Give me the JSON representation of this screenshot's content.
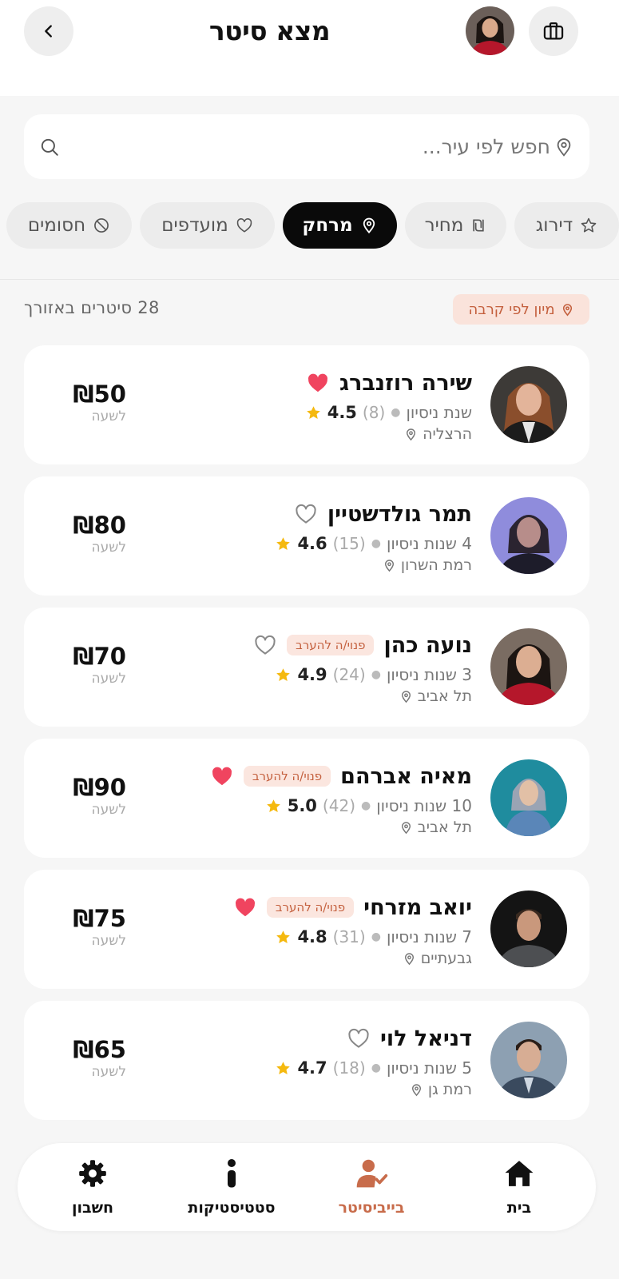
{
  "header": {
    "title": "מצא סיטר",
    "back_icon": "chevron-left-icon",
    "bag_icon": "briefcase-icon"
  },
  "search": {
    "placeholder": "חפש לפי עיר...",
    "value": ""
  },
  "filters": [
    {
      "label": "דירוג",
      "icon": "star-outline-icon",
      "active": false
    },
    {
      "label": "מחיר",
      "icon": "shekel-icon",
      "active": false
    },
    {
      "label": "מרחק",
      "icon": "map-pin-icon",
      "active": true
    },
    {
      "label": "מועדפים",
      "icon": "heart-outline-icon",
      "active": false
    },
    {
      "label": "חסומים",
      "icon": "block-icon",
      "active": false
    }
  ],
  "results": {
    "count_text": "28 סיטרים באזורך",
    "sort_label": "מיון לפי קרבה"
  },
  "sitters": [
    {
      "name": "שירה רוזנברג",
      "badge": "",
      "favorite": true,
      "experience": "שנת ניסיון",
      "reviews": "(8)",
      "rating": "4.5",
      "city": "הרצליה",
      "price": "₪50",
      "per": "לשעה"
    },
    {
      "name": "תמר גולדשטיין",
      "badge": "",
      "favorite": false,
      "experience": "4 שנות ניסיון",
      "reviews": "(15)",
      "rating": "4.6",
      "city": "רמת השרון",
      "price": "₪80",
      "per": "לשעה"
    },
    {
      "name": "נועה כהן",
      "badge": "פנוי/ה להערב",
      "favorite": false,
      "experience": "3 שנות ניסיון",
      "reviews": "(24)",
      "rating": "4.9",
      "city": "תל אביב",
      "price": "₪70",
      "per": "לשעה"
    },
    {
      "name": "מאיה אברהם",
      "badge": "פנוי/ה להערב",
      "favorite": true,
      "experience": "10 שנות ניסיון",
      "reviews": "(42)",
      "rating": "5.0",
      "city": "תל אביב",
      "price": "₪90",
      "per": "לשעה"
    },
    {
      "name": "יואב מזרחי",
      "badge": "פנוי/ה להערב",
      "favorite": true,
      "experience": "7 שנות ניסיון",
      "reviews": "(31)",
      "rating": "4.8",
      "city": "גבעתיים",
      "price": "₪75",
      "per": "לשעה"
    },
    {
      "name": "דניאל לוי",
      "badge": "",
      "favorite": false,
      "experience": "5 שנות ניסיון",
      "reviews": "(18)",
      "rating": "4.7",
      "city": "רמת גן",
      "price": "₪65",
      "per": "לשעה"
    }
  ],
  "nav": [
    {
      "label": "בית",
      "icon": "home-icon",
      "active": false
    },
    {
      "label": "בייביסיטר",
      "icon": "babysitter-icon",
      "active": true
    },
    {
      "label": "סטטיסטיקות",
      "icon": "info-icon",
      "active": false
    },
    {
      "label": "חשבון",
      "icon": "gear-icon",
      "active": false
    }
  ],
  "colors": {
    "accent": "#c86c4b",
    "heart": "#f0445f",
    "star": "#f5b90f",
    "chip_active": "#0a0a0a"
  }
}
